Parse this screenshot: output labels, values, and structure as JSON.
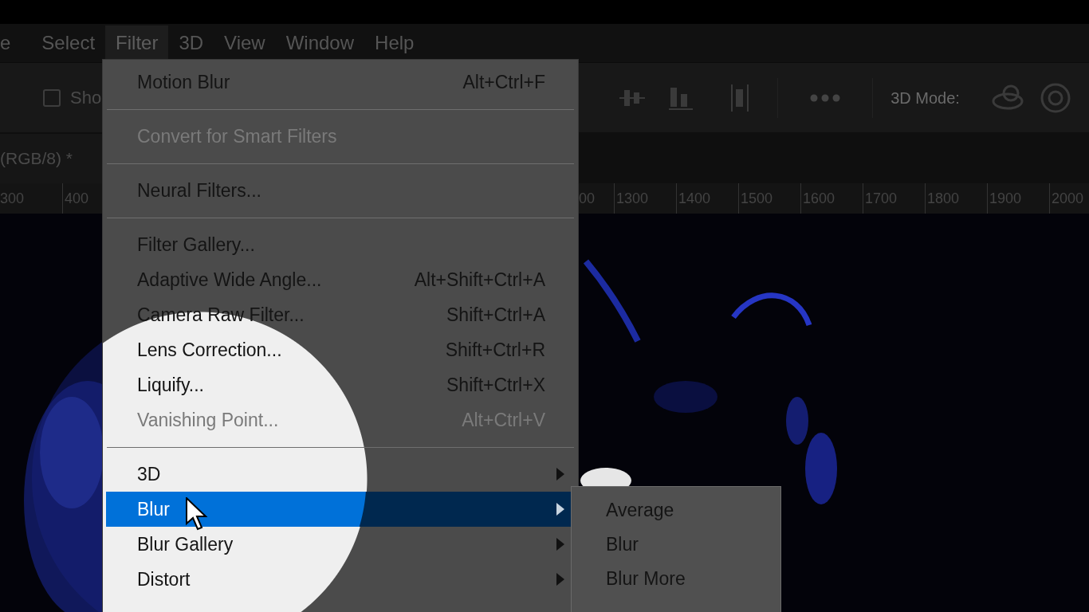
{
  "menu_bar": {
    "items": [
      {
        "label": "e",
        "selected": false
      },
      {
        "label": "Select",
        "selected": false
      },
      {
        "label": "Filter",
        "selected": true
      },
      {
        "label": "3D",
        "selected": false
      },
      {
        "label": "View",
        "selected": false
      },
      {
        "label": "Window",
        "selected": false
      },
      {
        "label": "Help",
        "selected": false
      }
    ]
  },
  "options_bar": {
    "checkbox": {
      "label": "Sho",
      "checked": false
    },
    "mode_label": "3D Mode:"
  },
  "document_tab": {
    "title": "(RGB/8) *"
  },
  "ruler": {
    "left_labels": [
      "300",
      "400"
    ],
    "right_labels": [
      "00",
      "1300",
      "1400",
      "1500",
      "1600",
      "1700",
      "1800",
      "1900",
      "2000"
    ]
  },
  "filter_menu": {
    "items": [
      {
        "kind": "item",
        "label": "Motion Blur",
        "shortcut": "Alt+Ctrl+F",
        "disabled": false,
        "selected": false,
        "submenu": false
      },
      {
        "kind": "separator"
      },
      {
        "kind": "item",
        "label": "Convert for Smart Filters",
        "disabled": true,
        "selected": false,
        "submenu": false
      },
      {
        "kind": "separator"
      },
      {
        "kind": "item",
        "label": "Neural Filters...",
        "disabled": false,
        "selected": false,
        "submenu": false
      },
      {
        "kind": "separator"
      },
      {
        "kind": "item",
        "label": "Filter Gallery...",
        "disabled": false,
        "selected": false,
        "submenu": false
      },
      {
        "kind": "item",
        "label": "Adaptive Wide Angle...",
        "shortcut": "Alt+Shift+Ctrl+A",
        "disabled": false,
        "selected": false,
        "submenu": false
      },
      {
        "kind": "item",
        "label": "Camera Raw Filter...",
        "shortcut": "Shift+Ctrl+A",
        "disabled": false,
        "selected": false,
        "submenu": false
      },
      {
        "kind": "item",
        "label": "Lens Correction...",
        "shortcut": "Shift+Ctrl+R",
        "disabled": false,
        "selected": false,
        "submenu": false
      },
      {
        "kind": "item",
        "label": "Liquify...",
        "shortcut": "Shift+Ctrl+X",
        "disabled": false,
        "selected": false,
        "submenu": false
      },
      {
        "kind": "item",
        "label": "Vanishing Point...",
        "shortcut": "Alt+Ctrl+V",
        "disabled": true,
        "selected": false,
        "submenu": false
      },
      {
        "kind": "separator"
      },
      {
        "kind": "item",
        "label": "3D",
        "disabled": false,
        "selected": false,
        "submenu": true
      },
      {
        "kind": "item",
        "label": "Blur",
        "disabled": false,
        "selected": true,
        "submenu": true
      },
      {
        "kind": "item",
        "label": "Blur Gallery",
        "disabled": false,
        "selected": false,
        "submenu": true
      },
      {
        "kind": "item",
        "label": "Distort",
        "disabled": false,
        "selected": false,
        "submenu": true
      }
    ]
  },
  "blur_submenu": {
    "items": [
      {
        "label": "Average"
      },
      {
        "label": "Blur"
      },
      {
        "label": "Blur More"
      }
    ]
  }
}
